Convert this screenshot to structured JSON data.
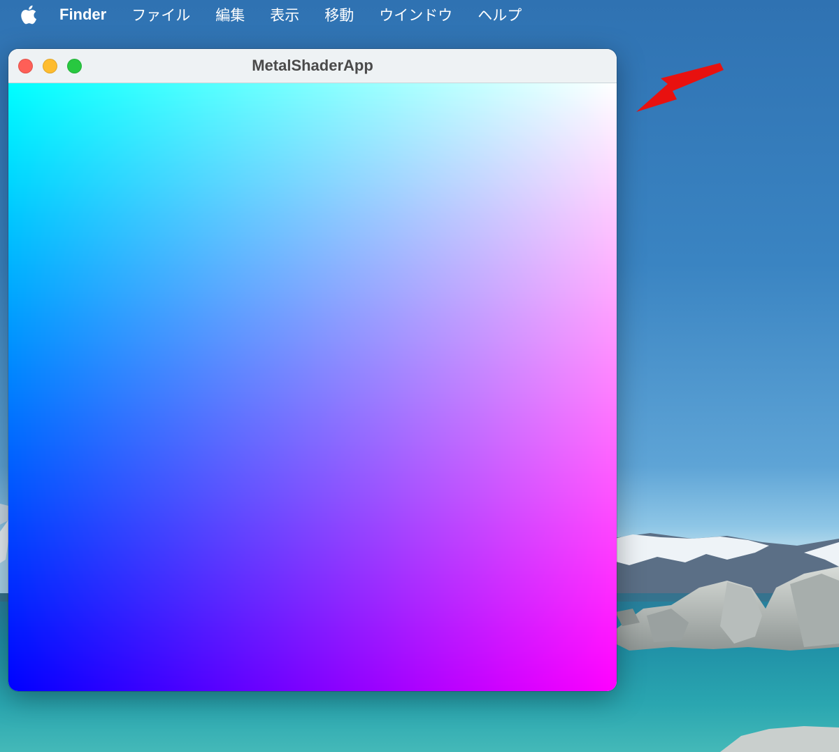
{
  "menubar": {
    "app_name": "Finder",
    "items": [
      "ファイル",
      "編集",
      "表示",
      "移動",
      "ウインドウ",
      "ヘルプ"
    ]
  },
  "window": {
    "title": "MetalShaderApp",
    "controls": {
      "close_color": "#fe5f57",
      "minimize_color": "#febc2e",
      "zoom_color": "#28c840"
    },
    "canvas_gradient": {
      "top_left": "#00ffff",
      "top_right": "#ffffff",
      "bottom_left": "#0000ff",
      "bottom_right": "#ff00ff"
    }
  },
  "annotation": {
    "arrow_color": "#e8110f"
  },
  "icons": {
    "apple": "apple-logo-icon",
    "arrow": "red-arrow-icon"
  }
}
